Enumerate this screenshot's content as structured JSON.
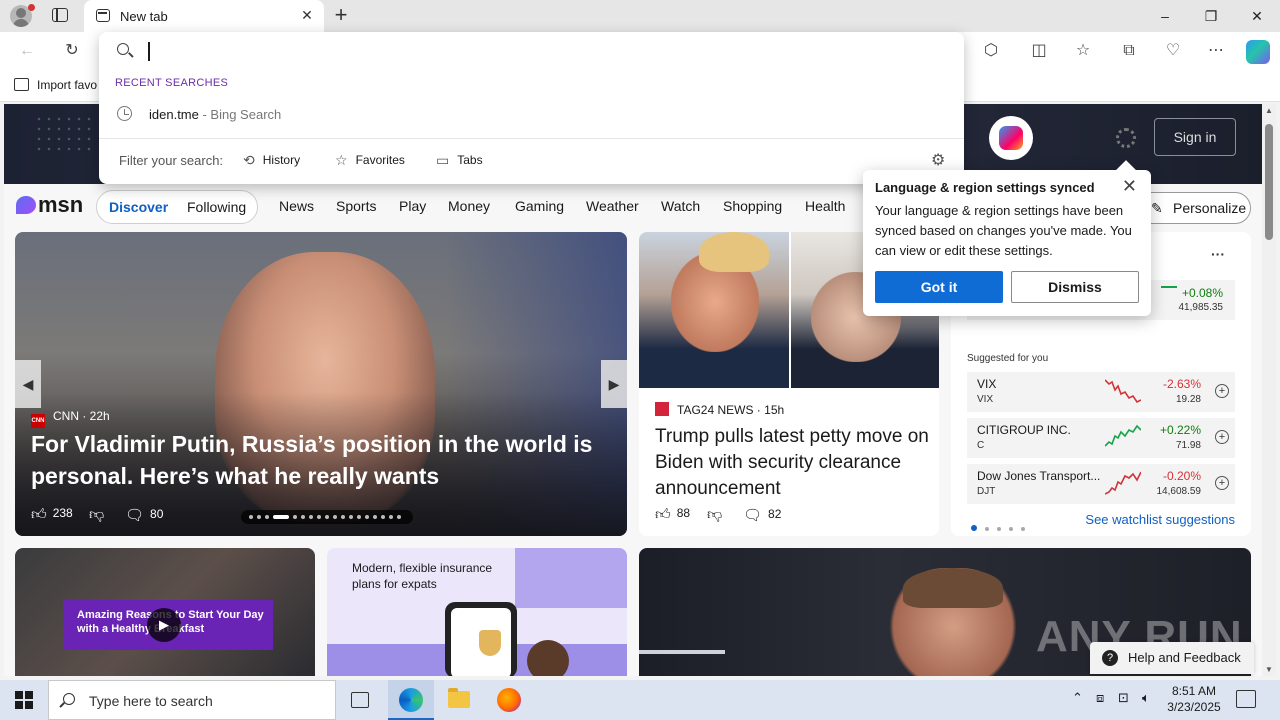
{
  "browser": {
    "tab_title": "New tab",
    "bookmark_import": "Import favo"
  },
  "omnibox": {
    "value": "",
    "recent_label": "RECENT SEARCHES",
    "recent_query": "iden.tme",
    "recent_source": " - Bing Search",
    "filter_label": "Filter your search:",
    "filters": [
      "History",
      "Favorites",
      "Tabs"
    ]
  },
  "msn": {
    "logo": "msn",
    "sign_in": "Sign in",
    "tabs": [
      "Discover",
      "Following"
    ],
    "nav": [
      "News",
      "Sports",
      "Play",
      "Money",
      "Gaming",
      "Weather",
      "Watch",
      "Shopping",
      "Health"
    ],
    "personalize": "Personalize"
  },
  "popup": {
    "title": "Language & region settings synced",
    "body": "Your language & region settings have been synced based on changes you've made. You can view or edit these settings.",
    "got_it": "Got it",
    "dismiss": "Dismiss"
  },
  "main_story": {
    "source": "CNN",
    "age": "22h",
    "headline": "For Vladimir Putin, Russia’s position in the world is personal. Here’s what he really wants",
    "likes": "238",
    "comments": "80"
  },
  "second_story": {
    "source": "TAG24 NEWS",
    "age": "15h",
    "headline": "Trump pulls latest petty move on Biden with security clearance announcement",
    "likes": "88",
    "comments": "82"
  },
  "watchlist": {
    "top_change": "+0.08%",
    "top_price": "41,985.35",
    "suggested_label": "Suggested for you",
    "stocks": [
      {
        "name": "VIX",
        "symbol": "VIX",
        "change": "-2.63%",
        "price": "19.28",
        "color": "#d13438"
      },
      {
        "name": "CITIGROUP INC.",
        "symbol": "C",
        "change": "+0.22%",
        "price": "71.98",
        "color": "#107c10"
      },
      {
        "name": "Dow Jones Transport...",
        "symbol": "DJT",
        "change": "-0.20%",
        "price": "14,608.59",
        "color": "#d13438"
      }
    ],
    "link": "See watchlist suggestions"
  },
  "promo_cards": {
    "breakfast": "Amazing Reasons to Start Your Day with a Healthy Breakfast",
    "insurance": "Modern, flexible insurance plans for expats"
  },
  "overlay": {
    "watermark": "ANY RUN",
    "help": "Help and Feedback"
  },
  "taskbar": {
    "search_placeholder": "Type here to search",
    "time": "8:51 AM",
    "date": "3/23/2025"
  }
}
